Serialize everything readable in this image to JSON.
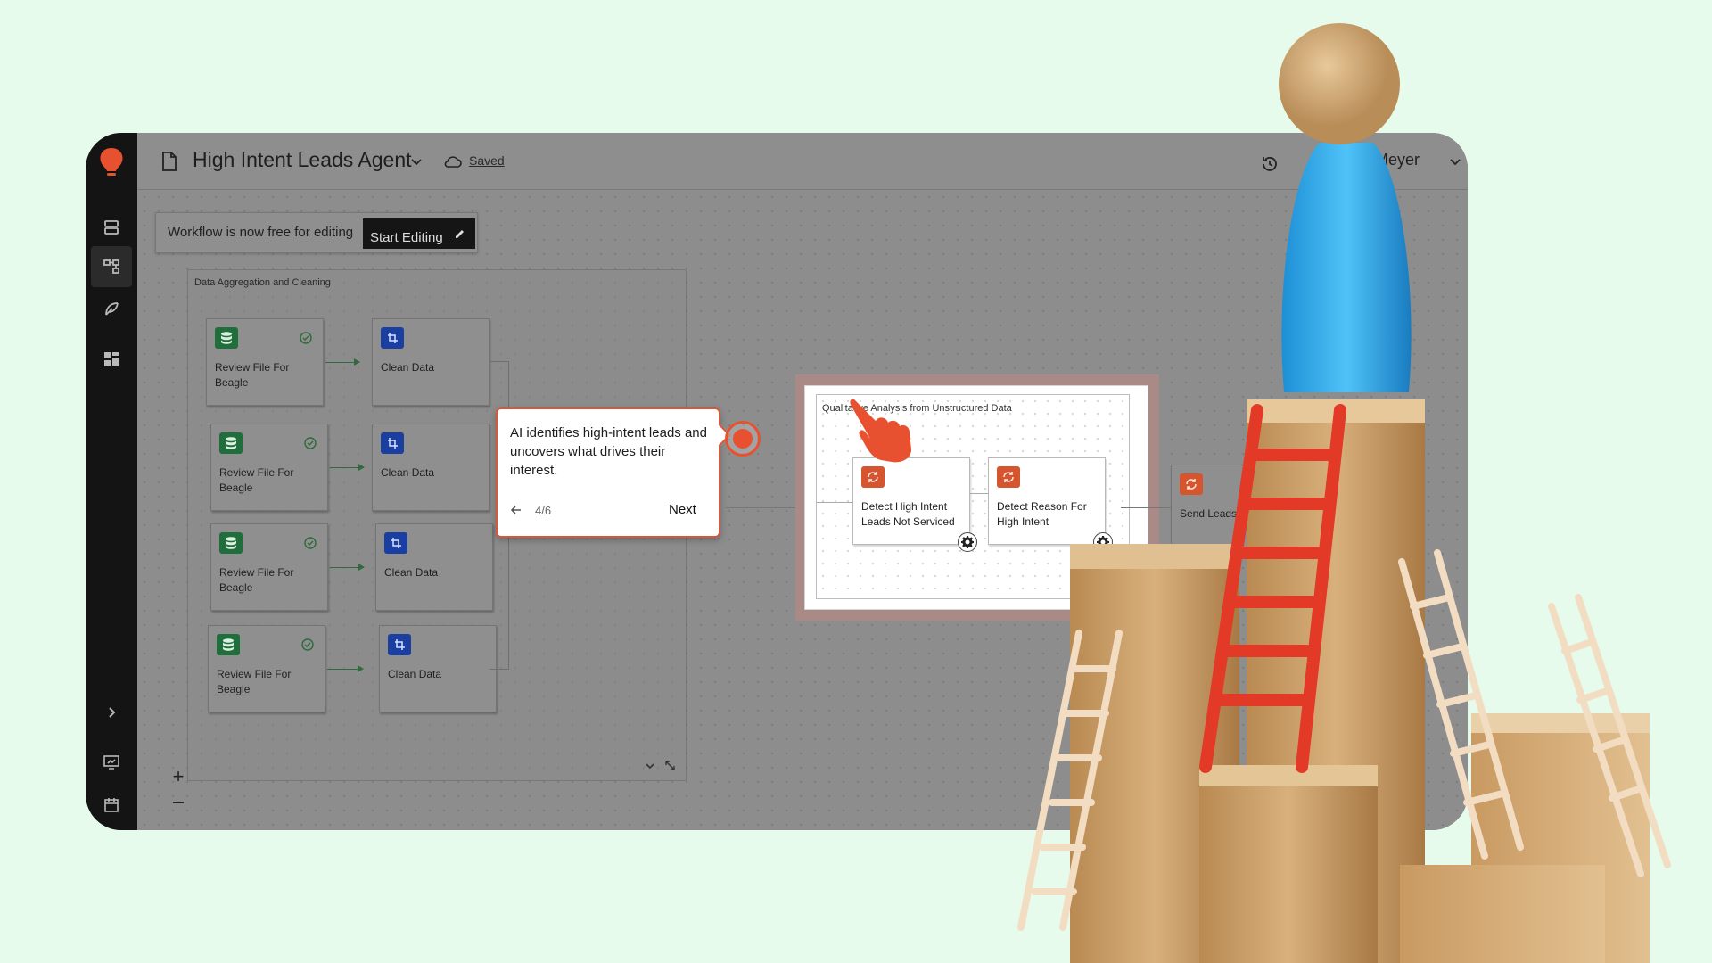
{
  "header": {
    "title": "High Intent Leads Agent",
    "save_status": "Saved",
    "user_name": "Meyer"
  },
  "edit_bar": {
    "message": "Workflow is now free for editing",
    "start_label": "Start Editing"
  },
  "group_main": {
    "label": "Data Aggregation and Cleaning",
    "rows": [
      {
        "review": "Review File For Beagle",
        "clean": "Clean Data"
      },
      {
        "review": "Review File For Beagle",
        "clean": "Clean Data"
      },
      {
        "review": "Review File For Beagle",
        "clean": "Clean Data"
      },
      {
        "review": "Review File For Beagle",
        "clean": "Clean Data"
      }
    ]
  },
  "tooltip": {
    "text": "AI identifies high-intent leads and uncovers what drives their interest.",
    "step": "4/6",
    "next_label": "Next"
  },
  "group_highlight": {
    "label": "Qualitative Analysis from Unstructured Data",
    "nodes": [
      "Detect High Intent Leads Not Serviced",
      "Detect Reason For High Intent"
    ]
  },
  "crm_node": {
    "label": "Send Leads To CRM"
  },
  "zoom": {
    "in": "+",
    "out": "–"
  },
  "colors": {
    "accent": "#e8512f",
    "green": "#1f6e3c",
    "blue": "#1a3fa0",
    "background": "#e6fbeb"
  }
}
